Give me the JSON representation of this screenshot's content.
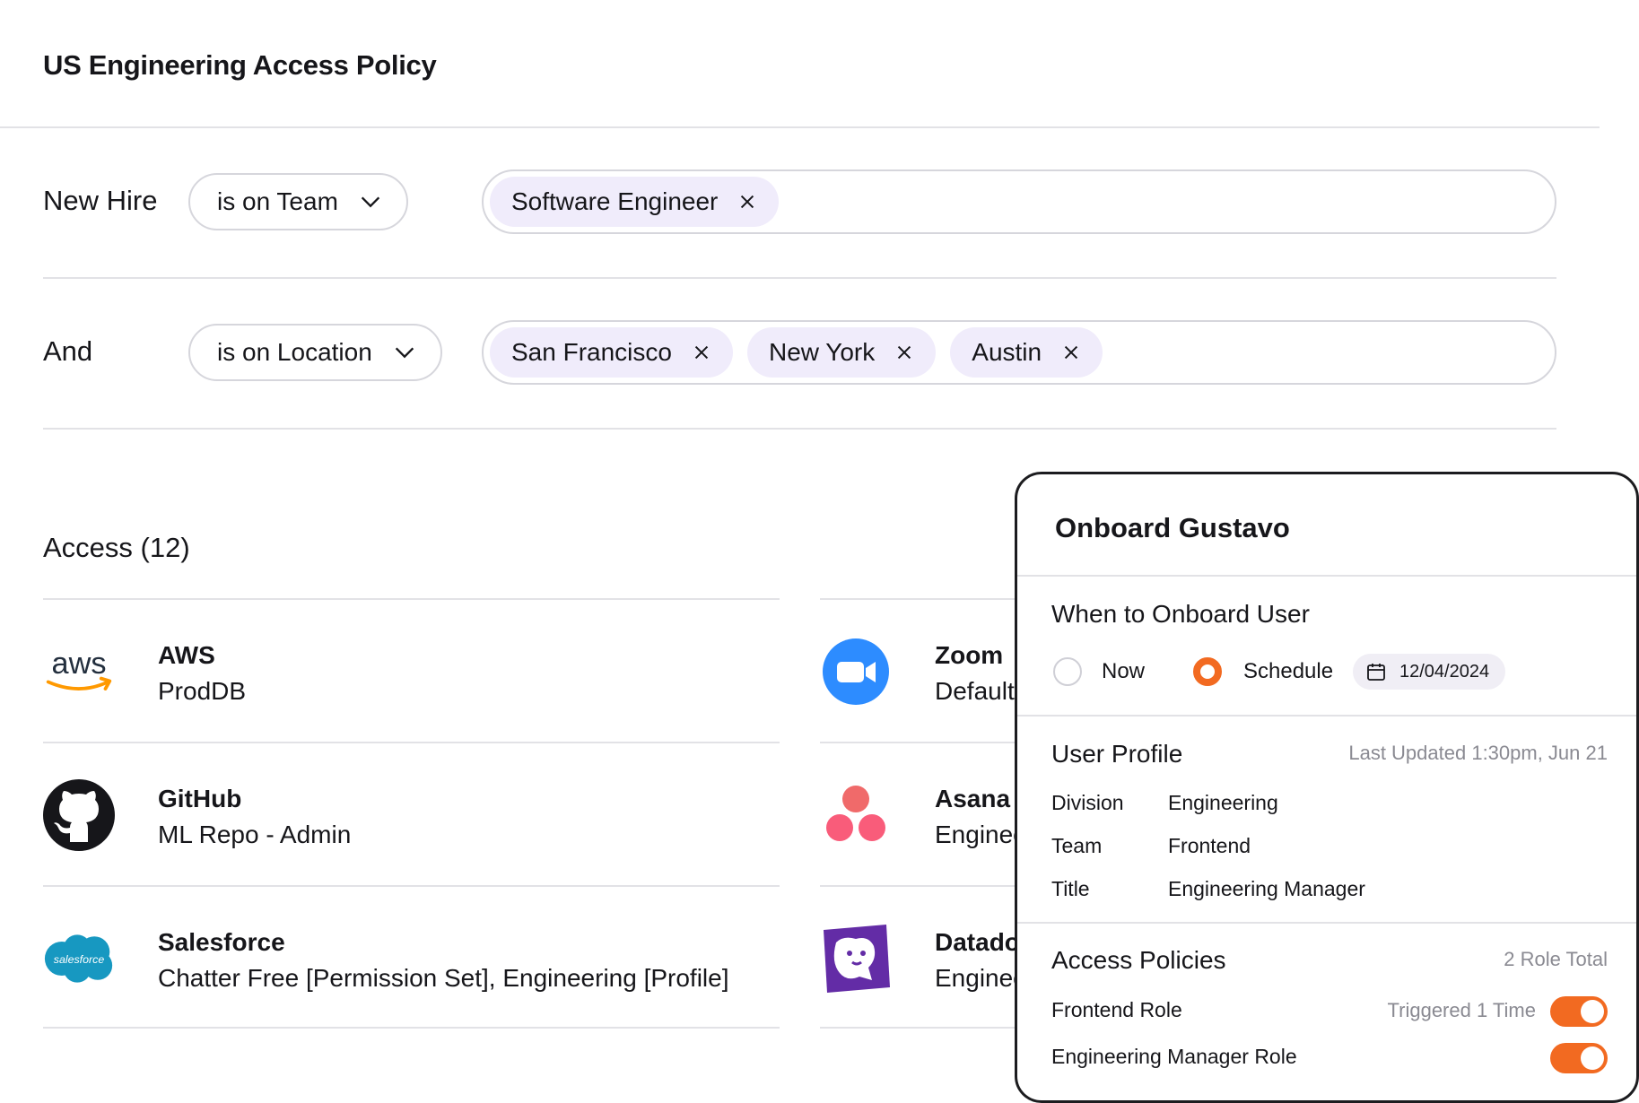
{
  "page": {
    "title": "US Engineering Access Policy"
  },
  "rules": [
    {
      "label": "New Hire",
      "operator": "is on Team",
      "values": [
        "Software Engineer"
      ]
    },
    {
      "label": "And",
      "operator": "is on Location",
      "values": [
        "San Francisco",
        "New York",
        "Austin"
      ]
    }
  ],
  "access": {
    "title": "Access (12)",
    "left_apps": [
      {
        "icon": "aws-logo-icon",
        "name": "AWS",
        "detail": "ProdDB"
      },
      {
        "icon": "github-logo-icon",
        "name": "GitHub",
        "detail": "ML Repo - Admin"
      },
      {
        "icon": "salesforce-logo-icon",
        "name": "Salesforce",
        "detail": "Chatter Free [Permission Set], Engineering [Profile]"
      }
    ],
    "right_apps": [
      {
        "icon": "zoom-logo-icon",
        "name": "Zoom",
        "detail": "Default"
      },
      {
        "icon": "asana-logo-icon",
        "name": "Asana",
        "detail": "Engineering"
      },
      {
        "icon": "datadog-logo-icon",
        "name": "Datadog",
        "detail": "Engineering"
      }
    ],
    "salesforce_logo_text": "salesforce",
    "aws_logo_text": "aws"
  },
  "panel": {
    "title": "Onboard Gustavo",
    "when": {
      "title": "When to Onboard User",
      "options": [
        "Now",
        "Schedule"
      ],
      "selected": "Schedule",
      "date": "12/04/2024"
    },
    "profile": {
      "title": "User Profile",
      "last_updated": "Last Updated 1:30pm, Jun 21",
      "fields": [
        {
          "key": "Division",
          "value": "Engineering"
        },
        {
          "key": "Team",
          "value": "Frontend"
        },
        {
          "key": "Title",
          "value": "Engineering Manager"
        }
      ]
    },
    "policies": {
      "title": "Access Policies",
      "total": "2 Role Total",
      "items": [
        {
          "name": "Frontend Role",
          "meta": "Triggered 1 Time",
          "enabled": true
        },
        {
          "name": "Engineering Manager Role",
          "meta": "",
          "enabled": true
        }
      ]
    }
  },
  "colors": {
    "accent": "#f26a21",
    "chip": "#f0ecfb",
    "divider": "#e2e2e6"
  }
}
